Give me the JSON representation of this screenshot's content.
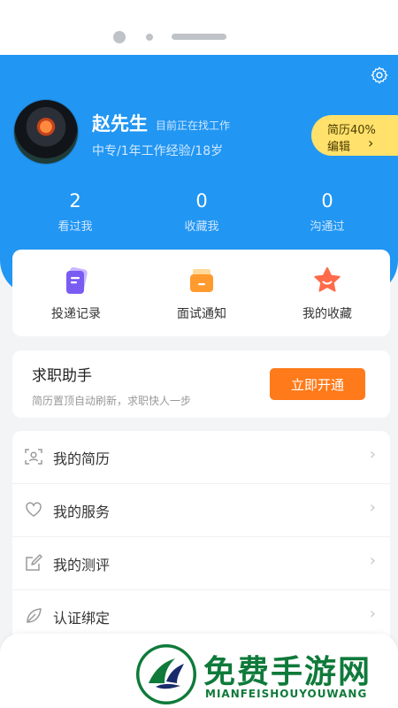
{
  "header": {
    "user_name": "赵先生",
    "job_status": "目前正在找工作",
    "user_meta": "中专/1年工作经验/18岁",
    "resume_pill": {
      "line1": "简历40%",
      "line2": "编辑"
    }
  },
  "stats": [
    {
      "num": "2",
      "label": "看过我"
    },
    {
      "num": "0",
      "label": "收藏我"
    },
    {
      "num": "0",
      "label": "沟通过"
    }
  ],
  "quick_actions": [
    {
      "label": "投递记录",
      "icon": "document-icon"
    },
    {
      "label": "面试通知",
      "icon": "envelope-icon"
    },
    {
      "label": "我的收藏",
      "icon": "star-icon"
    }
  ],
  "job_helper": {
    "title": "求职助手",
    "subtitle": "简历置顶自动刷新，求职快人一步",
    "button": "立即开通"
  },
  "menu": [
    {
      "label": "我的简历",
      "icon": "resume-icon"
    },
    {
      "label": "我的服务",
      "icon": "heart-icon"
    },
    {
      "label": "我的测评",
      "icon": "edit-icon"
    },
    {
      "label": "认证绑定",
      "icon": "leaf-icon"
    }
  ],
  "watermark": {
    "title": "免费手游网",
    "subtitle": "MIANFEISHOUYOUWANG"
  },
  "colors": {
    "primary": "#2196f3",
    "accent": "#ff7a1a",
    "pill": "#ffe16b",
    "watermark": "#0f7a3a"
  }
}
